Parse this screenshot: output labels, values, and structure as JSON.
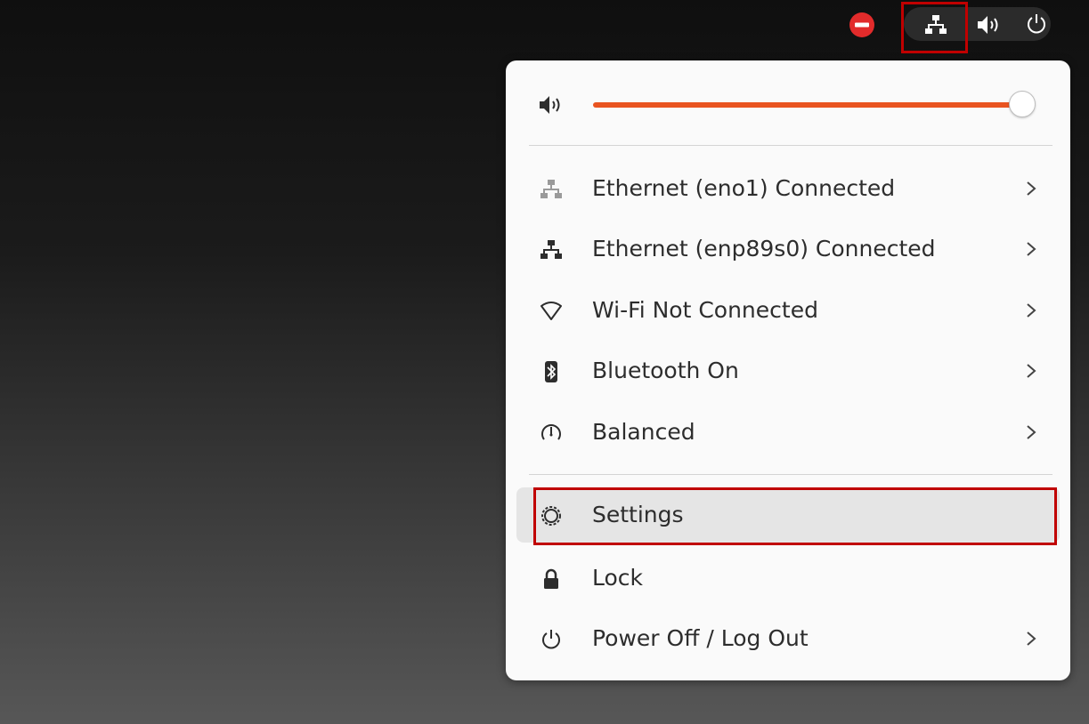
{
  "topbar": {
    "icons": [
      "do-not-disturb-icon",
      "network-wired-icon",
      "volume-icon",
      "power-icon"
    ]
  },
  "menu": {
    "volume": {
      "level_percent": 100,
      "icon": "volume-icon",
      "accent": "#e95420"
    },
    "items": [
      {
        "label": "Ethernet (eno1) Connected",
        "icon": "network-wired-icon",
        "has_submenu": true
      },
      {
        "label": "Ethernet (enp89s0) Connected",
        "icon": "network-wired-icon",
        "has_submenu": true
      },
      {
        "label": "Wi-Fi Not Connected",
        "icon": "wifi-icon",
        "has_submenu": true
      },
      {
        "label": "Bluetooth On",
        "icon": "bluetooth-icon",
        "has_submenu": true
      },
      {
        "label": "Balanced",
        "icon": "power-profile-icon",
        "has_submenu": true
      }
    ],
    "system_items": [
      {
        "label": "Settings",
        "icon": "gear-icon",
        "has_submenu": false,
        "highlighted": true
      },
      {
        "label": "Lock",
        "icon": "lock-icon",
        "has_submenu": false
      },
      {
        "label": "Power Off / Log Out",
        "icon": "power-icon",
        "has_submenu": true
      }
    ]
  },
  "colors": {
    "highlight_box": "#c00000",
    "dnd_red": "#e22b2b"
  }
}
